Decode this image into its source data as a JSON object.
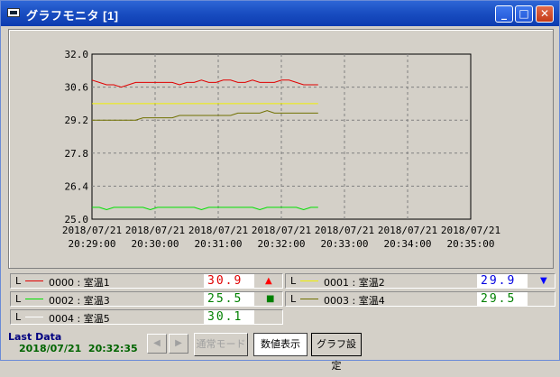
{
  "window": {
    "title": "グラフモニタ [1]",
    "controls": {
      "minimize": "_",
      "maximize": "□",
      "close": "✕"
    }
  },
  "chart_data": {
    "type": "line",
    "title": "",
    "xlabel": "",
    "ylabel": "",
    "ylim": [
      25.0,
      32.0
    ],
    "y_ticks": [
      "32.0",
      "30.6",
      "29.2",
      "27.8",
      "26.4",
      "25.0"
    ],
    "x_ticks": [
      {
        "date": "2018/07/21",
        "time": "20:29:00"
      },
      {
        "date": "2018/07/21",
        "time": "20:30:00"
      },
      {
        "date": "2018/07/21",
        "time": "20:31:00"
      },
      {
        "date": "2018/07/21",
        "time": "20:32:00"
      },
      {
        "date": "2018/07/21",
        "time": "20:33:00"
      },
      {
        "date": "2018/07/21",
        "time": "20:34:00"
      },
      {
        "date": "2018/07/21",
        "time": "20:35:00"
      }
    ],
    "xlim": [
      "20:29:00",
      "20:35:00"
    ],
    "grid": true,
    "series": [
      {
        "name": "室温1",
        "color": "#e00000",
        "start": "20:29:00",
        "end": "20:32:35",
        "values": [
          30.9,
          30.8,
          30.7,
          30.7,
          30.6,
          30.7,
          30.8,
          30.8,
          30.8,
          30.8,
          30.8,
          30.8,
          30.7,
          30.8,
          30.8,
          30.9,
          30.8,
          30.8,
          30.9,
          30.9,
          30.8,
          30.8,
          30.9,
          30.8,
          30.8,
          30.8,
          30.9,
          30.9,
          30.8,
          30.7,
          30.7,
          30.7
        ]
      },
      {
        "name": "室温2",
        "color": "#f0f000",
        "start": "20:29:00",
        "end": "20:32:35",
        "values": [
          29.9,
          29.9,
          29.9,
          29.9,
          29.9,
          29.9,
          29.9,
          29.9,
          29.9,
          29.9,
          29.9,
          29.9,
          29.9,
          29.9,
          29.9,
          29.9,
          29.9,
          29.9,
          29.9,
          29.9,
          29.9,
          29.9,
          29.9,
          29.9,
          29.9,
          29.9,
          29.9,
          29.9,
          29.9,
          29.9,
          29.9,
          29.9
        ]
      },
      {
        "name": "室温4",
        "color": "#707000",
        "start": "20:29:00",
        "end": "20:32:35",
        "values": [
          29.2,
          29.2,
          29.2,
          29.2,
          29.2,
          29.2,
          29.2,
          29.3,
          29.3,
          29.3,
          29.3,
          29.3,
          29.4,
          29.4,
          29.4,
          29.4,
          29.4,
          29.4,
          29.4,
          29.4,
          29.5,
          29.5,
          29.5,
          29.5,
          29.6,
          29.5,
          29.5,
          29.5,
          29.5,
          29.5,
          29.5,
          29.5
        ]
      },
      {
        "name": "室温3",
        "color": "#00e000",
        "start": "20:29:00",
        "end": "20:32:35",
        "values": [
          25.5,
          25.5,
          25.4,
          25.5,
          25.5,
          25.5,
          25.5,
          25.5,
          25.4,
          25.5,
          25.5,
          25.5,
          25.5,
          25.5,
          25.5,
          25.4,
          25.5,
          25.5,
          25.5,
          25.5,
          25.5,
          25.5,
          25.5,
          25.4,
          25.5,
          25.5,
          25.5,
          25.5,
          25.5,
          25.4,
          25.5,
          25.5
        ]
      },
      {
        "name": "室温5",
        "color": "#ffffff",
        "start": "20:29:00",
        "end": "20:32:35",
        "values": []
      }
    ]
  },
  "legend": [
    {
      "id": "0000",
      "sep": " : ",
      "name": "室温1",
      "value": "30.9",
      "value_color": "#e00000",
      "line_color": "#e00000",
      "indicator": "▲",
      "indicator_color": "#ff0000"
    },
    {
      "id": "0001",
      "sep": " : ",
      "name": "室温2",
      "value": "29.9",
      "value_color": "#0000e0",
      "line_color": "#f0f000",
      "indicator": "▼",
      "indicator_color": "#0000ff"
    },
    {
      "id": "0002",
      "sep": " : ",
      "name": "室温3",
      "value": "25.5",
      "value_color": "#008000",
      "line_color": "#00e000",
      "indicator": "■",
      "indicator_color": "#008000"
    },
    {
      "id": "0003",
      "sep": " : ",
      "name": "室温4",
      "value": "29.5",
      "value_color": "#008000",
      "line_color": "#707000",
      "indicator": "",
      "indicator_color": "#008000"
    },
    {
      "id": "0004",
      "sep": " : ",
      "name": "室温5",
      "value": "30.1",
      "value_color": "#008000",
      "line_color": "#ffffff",
      "indicator": "",
      "indicator_color": "#008000"
    }
  ],
  "legend_prefix": "L",
  "footer": {
    "last_data_label": "Last Data",
    "last_data_value": "2018/07/21  20:32:35",
    "prev_icon": "◀",
    "next_icon": "▶",
    "normal_mode_label": "通常モード",
    "numeric_view_label": "数値表示",
    "graph_settings_label": "グラフ設定"
  }
}
